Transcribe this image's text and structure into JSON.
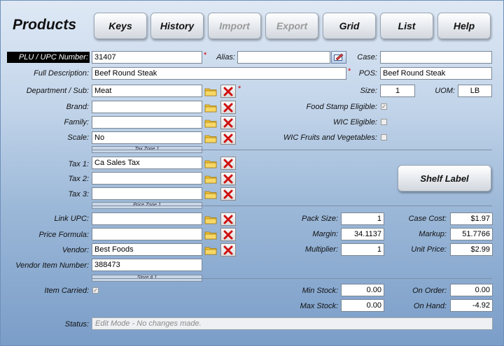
{
  "page": {
    "title": "Products"
  },
  "toolbar": [
    {
      "label": "Keys",
      "enabled": true
    },
    {
      "label": "History",
      "enabled": true
    },
    {
      "label": "Import",
      "enabled": false
    },
    {
      "label": "Export",
      "enabled": false
    },
    {
      "label": "Grid",
      "enabled": true
    },
    {
      "label": "List",
      "enabled": true
    },
    {
      "label": "Help",
      "enabled": true
    }
  ],
  "labels": {
    "plu": "PLU / UPC Number:",
    "alias": "Alias:",
    "case": "Case:",
    "full_description": "Full Description:",
    "pos": "POS:",
    "department": "Department / Sub:",
    "size": "Size:",
    "uom": "UOM:",
    "brand": "Brand:",
    "family": "Family:",
    "scale": "Scale:",
    "food_stamp": "Food Stamp Eligible:",
    "wic": "WIC Eligible:",
    "wic_fruits": "WIC Fruits and Vegetables:",
    "tax1": "Tax 1:",
    "tax2": "Tax 2:",
    "tax3": "Tax 3:",
    "link_upc": "Link UPC:",
    "price_formula": "Price Formula:",
    "vendor": "Vendor:",
    "vendor_item": "Vendor Item Number:",
    "pack_size": "Pack Size:",
    "margin": "Margin:",
    "multiplier": "Multiplier:",
    "case_cost": "Case Cost:",
    "markup": "Markup:",
    "unit_price": "Unit Price:",
    "item_carried": "Item Carried:",
    "min_stock": "Min Stock:",
    "max_stock": "Max Stock:",
    "on_order": "On Order:",
    "on_hand": "On Hand:",
    "status": "Status:"
  },
  "required_mark": "*",
  "zones": {
    "tax": "Tax Zone 1",
    "price": "Price Zone 1",
    "store": "Store # 1"
  },
  "values": {
    "plu": "31407",
    "alias": "",
    "case": "",
    "full_description": "Beef Round Steak",
    "pos": "Beef Round Steak",
    "department": "Meat",
    "size": "1",
    "uom": "LB",
    "brand": "",
    "family": "",
    "scale": "No",
    "tax1": "Ca Sales Tax",
    "tax2": "",
    "tax3": "",
    "link_upc": "",
    "price_formula": "",
    "vendor": "Best Foods",
    "vendor_item": "388473",
    "pack_size": "1",
    "margin": "34.1137",
    "multiplier": "1",
    "case_cost": "$1.97",
    "markup": "51.7766",
    "unit_price": "$2.99",
    "min_stock": "0.00",
    "max_stock": "0.00",
    "on_order": "0.00",
    "on_hand": "-4.92",
    "status": "Edit Mode - No changes made."
  },
  "checks": {
    "food_stamp": true,
    "wic": false,
    "wic_fruits": false,
    "item_carried": true
  },
  "shelf_label_button": "Shelf Label",
  "colors": {
    "required": "#d00000",
    "delete_x": "#d01010",
    "folder": "#f2c233"
  }
}
